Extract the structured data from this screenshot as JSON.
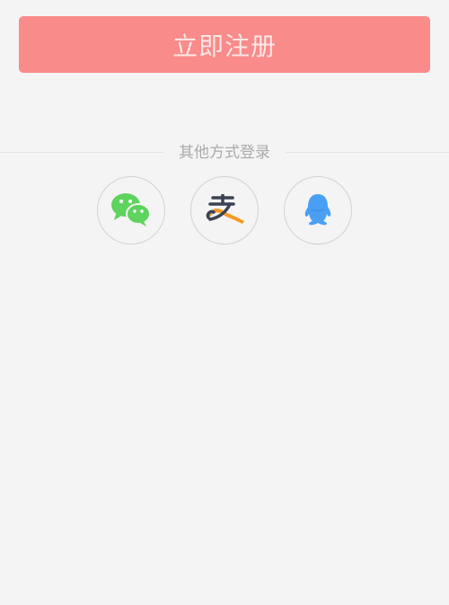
{
  "register": {
    "label": "立即注册",
    "color": "#f98b8a"
  },
  "divider": {
    "label": "其他方式登录"
  },
  "social": [
    {
      "name": "wechat",
      "icon": "wechat-icon",
      "color": "#5ed35e"
    },
    {
      "name": "alipay",
      "icon": "alipay-icon",
      "color": "#3a4253"
    },
    {
      "name": "qq",
      "icon": "qq-icon",
      "color": "#4a9ff5"
    }
  ]
}
